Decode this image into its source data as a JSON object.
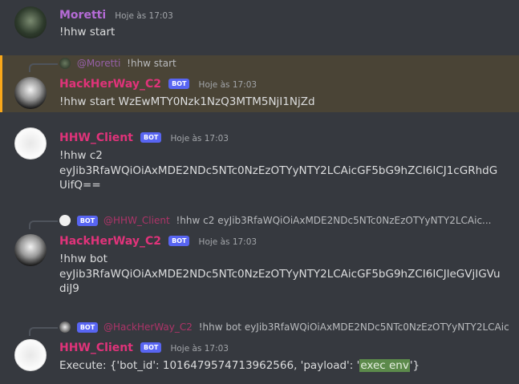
{
  "messages": [
    {
      "username": "Moretti",
      "username_color": "#b56bd6",
      "timestamp": "Hoje às 17:03",
      "text": "!hhw start"
    },
    {
      "reply": {
        "mention": "@Moretti",
        "text": "!hhw start"
      },
      "username": "HackHerWay_C2",
      "username_color": "#e0337a",
      "bot": "BOT",
      "timestamp": "Hoje às 17:03",
      "text": "!hhw start WzEwMTY0Nzk1NzQ3MTM5NjI1NjZd"
    },
    {
      "username": "HHW_Client",
      "username_color": "#e0337a",
      "bot": "BOT",
      "timestamp": "Hoje às 17:03",
      "line1": "!hhw c2",
      "line2": "eyJib3RfaWQiOiAxMDE2NDc5NTc0NzEzOTYyNTY2LCAicGF5bG9hZCI6ICJ1cGRhdGUifQ=="
    },
    {
      "reply": {
        "bot": "BOT",
        "mention": "@HHW_Client",
        "text": "!hhw c2 eyJib3RfaWQiOiAxMDE2NDc5NTc0NzEzOTYyNTY2LCAic..."
      },
      "username": "HackHerWay_C2",
      "username_color": "#e0337a",
      "bot": "BOT",
      "timestamp": "Hoje às 17:03",
      "line1": "!hhw bot",
      "line2": "eyJib3RfaWQiOiAxMDE2NDc5NTc0NzEzOTYyNTY2LCAicGF5bG9hZCI6ICJleGVjIGVudiJ9"
    },
    {
      "reply": {
        "bot": "BOT",
        "mention": "@HackHerWay_C2",
        "text": "!hhw bot eyJib3RfaWQiOiAxMDE2NDc5NTc0NzEzOTYyNTY2LCAicGF5bG9hZCI6..."
      },
      "username": "HHW_Client",
      "username_color": "#e0337a",
      "bot": "BOT",
      "timestamp": "Hoje às 17:03",
      "text_prefix": "Execute: {'bot_id': 1016479574713962566, 'payload': '",
      "text_highlight": "exec env",
      "text_suffix": "'}"
    }
  ],
  "colors": {
    "background": "#36393f",
    "bot_badge": "#5865f2",
    "highlight": "#4a4436"
  }
}
